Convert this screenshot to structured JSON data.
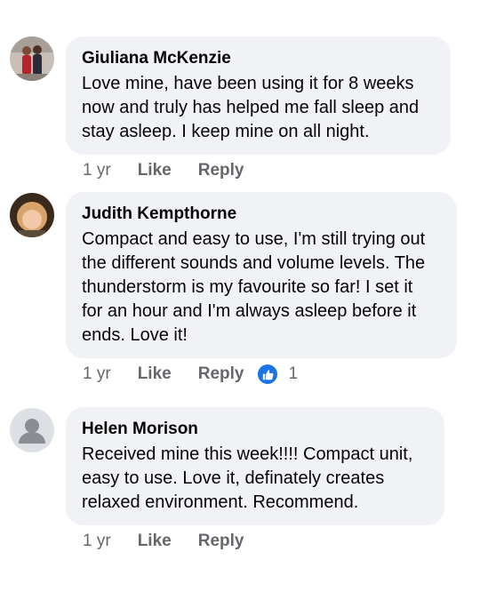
{
  "accent_color": "#1b74e4",
  "comments": [
    {
      "author": "Giuliana McKenzie",
      "text": "Love mine, have been using it for 8 weeks\nnow and truly has helped me fall sleep and\nstay asleep.  I keep mine on all night.",
      "time": "1 yr",
      "like_label": "Like",
      "reply_label": "Reply",
      "avatar_icon": "profile-photo"
    },
    {
      "author": "Judith Kempthorne",
      "text": "Compact and easy to use, I'm still trying out\nthe different sounds and volume levels. The\nthunderstorm is my favourite so far! I set it\nfor an hour and I'm always asleep before it\nends. Love it!",
      "time": "1 yr",
      "like_label": "Like",
      "reply_label": "Reply",
      "reaction_icon": "thumbs-up-icon",
      "reaction_count": "1",
      "avatar_icon": "profile-photo"
    },
    {
      "author": "Helen Morison",
      "text": "Received mine this week!!!!  Compact unit,\neasy to use.   Love it, definately creates\nrelaxed environment.  Recommend.",
      "time": "1 yr",
      "like_label": "Like",
      "reply_label": "Reply",
      "avatar_icon": "default-user-icon"
    }
  ]
}
